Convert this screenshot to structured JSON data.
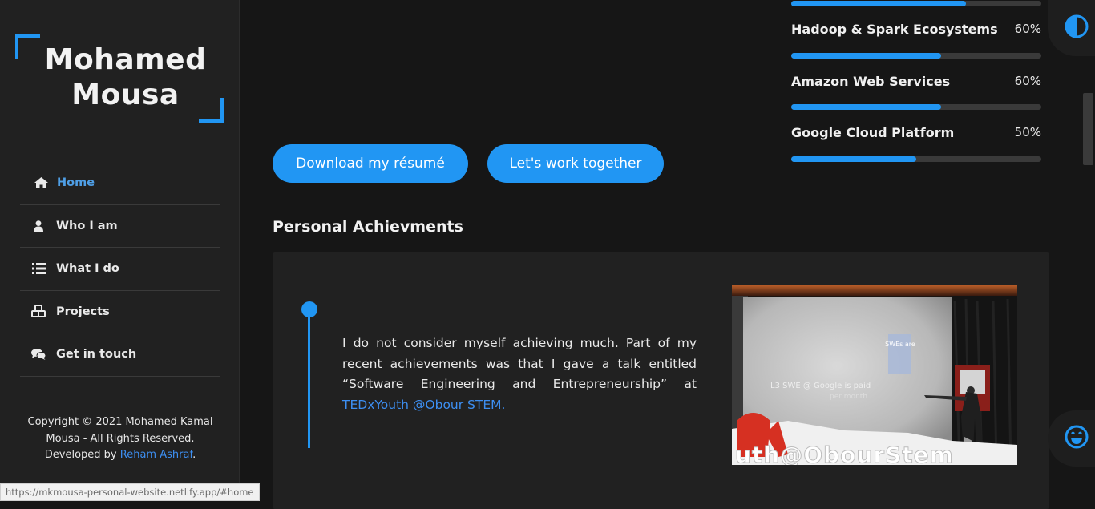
{
  "sidebar": {
    "logo_line1": "Mohamed",
    "logo_line2": "Mousa",
    "nav": [
      {
        "label": "Home",
        "icon": "home-icon",
        "active": true
      },
      {
        "label": "Who I am",
        "icon": "user-icon"
      },
      {
        "label": "What I do",
        "icon": "list-icon"
      },
      {
        "label": "Projects",
        "icon": "cubes-icon"
      },
      {
        "label": "Get in touch",
        "icon": "comments-icon"
      }
    ],
    "copyright_line1": "Copyright © 2021 Mohamed Kamal",
    "copyright_line2": "Mousa - All Rights Reserved.",
    "developed_by": "Developed by",
    "developer": "Reham Ashraf",
    "period": "."
  },
  "status_bar_url": "https://mkmousa-personal-website.netlify.app/#home",
  "skills": [
    {
      "name": "Hadoop & Spark Ecosystems",
      "percent_label": "60%",
      "percent": 60
    },
    {
      "name": "Amazon Web Services",
      "percent_label": "60%",
      "percent": 60
    },
    {
      "name": "Google Cloud Platform",
      "percent_label": "50%",
      "percent": 50
    }
  ],
  "top_skill_bar_percent": 70,
  "buttons": {
    "resume": "Download my résumé",
    "work": "Let's work together"
  },
  "achievements": {
    "title": "Personal Achievments",
    "text": "I do not consider myself achieving much. Part of my recent achievements was that I gave a talk entitled “Software Engineering and Entrepreneurship” at ",
    "link": "TEDxYouth @Obour STEM.",
    "photo": {
      "slide_label": "SWEs are",
      "slide_text": "L3 SWE @ Google is paid",
      "slide_text2": "per month",
      "stage_letters": "uth@ObourStem"
    }
  },
  "floating": {
    "theme_toggle_icon": "contrast-icon",
    "emoji_icon": "smile-icon"
  },
  "colors": {
    "accent": "#2196f3",
    "link": "#3d8ff2",
    "bg": "#161616",
    "panel": "#212121"
  }
}
